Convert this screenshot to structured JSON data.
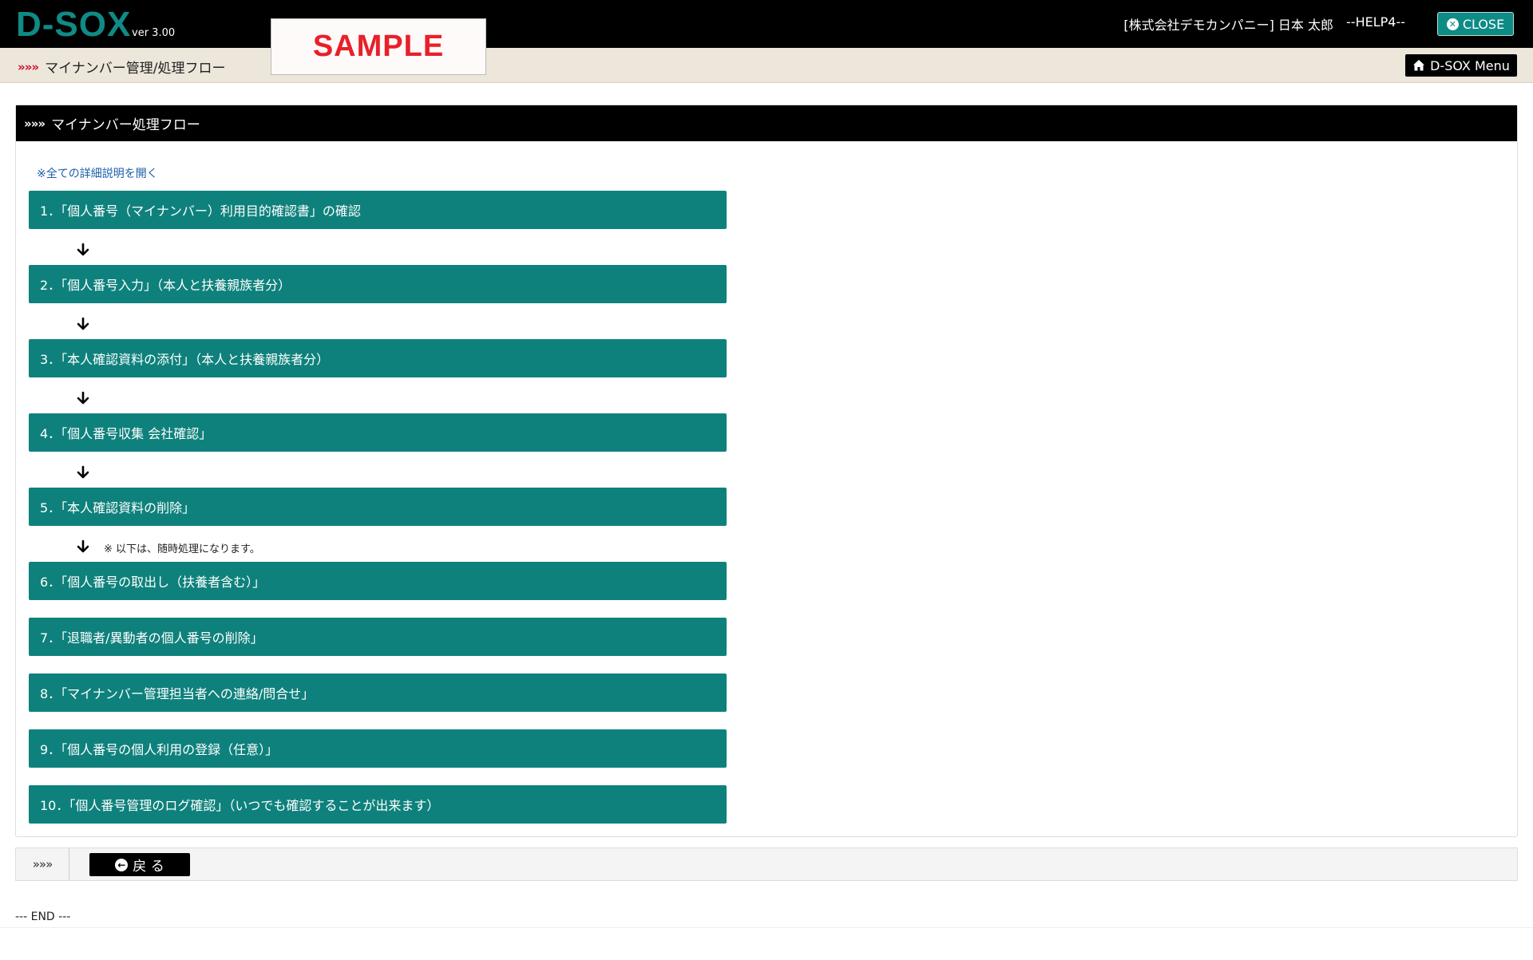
{
  "app": {
    "logo": "D-SOX",
    "version": "ver 3.00",
    "watermark": "SAMPLE",
    "user": "[株式会社デモカンパニー]  日本 太郎",
    "help": "--HELP4--",
    "close_label": "CLOSE"
  },
  "subbar": {
    "chevrons": "»»»",
    "breadcrumb": "マイナンバー管理/処理フロー",
    "menu_label": "D-SOX Menu"
  },
  "panel": {
    "chevrons": "»»»",
    "title": "マイナンバー処理フロー",
    "expand_all": "※全ての詳細説明を開く",
    "note": "※ 以下は、随時処理になります。",
    "steps": [
      "1．「個人番号（マイナンバー）利用目的確認書」の確認",
      "2．「個人番号入力」（本人と扶養親族者分）",
      "3．「本人確認資料の添付」（本人と扶養親族者分）",
      "4．「個人番号収集 会社確認」",
      "5．「本人確認資料の削除」",
      "6．「個人番号の取出し（扶養者含む）」",
      "7．「退職者/異動者の個人番号の削除」",
      "8．「マイナンバー管理担当者への連絡/問合せ」",
      "9．「個人番号の個人利用の登録（任意）」",
      "10．「個人番号管理のログ確認」（いつでも確認することが出来ます）"
    ]
  },
  "footer": {
    "chevrons": "»»»",
    "back_label": "戻 る",
    "end": "--- END ---"
  },
  "colors": {
    "accent": "#0f817c",
    "header_bg": "#000000",
    "subbar_bg": "#ede6da",
    "watermark": "#e8202a",
    "breadcrumb_chevron": "#c8102e"
  }
}
